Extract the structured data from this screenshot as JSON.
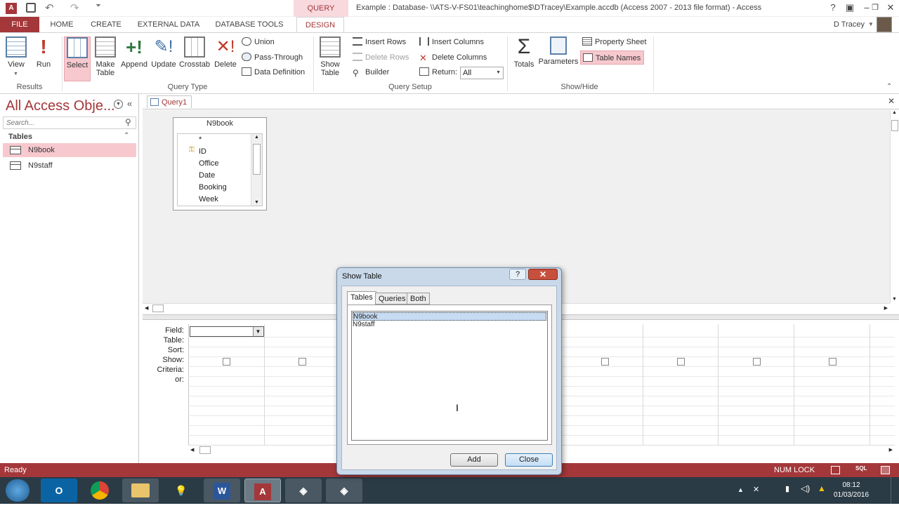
{
  "window": {
    "context_tab": "QUERY TOOLS",
    "title": "Example : Database- \\\\ATS-V-FS01\\teachinghome$\\DTracey\\Example.accdb (Access 2007 - 2013 file format) - Access",
    "help": "?"
  },
  "tabs": [
    "FILE",
    "HOME",
    "CREATE",
    "EXTERNAL DATA",
    "DATABASE TOOLS",
    "DESIGN"
  ],
  "user": "D Tracey",
  "ribbon": {
    "results": {
      "label": "Results",
      "view": "View",
      "run": "Run"
    },
    "query_type": {
      "label": "Query Type",
      "select": "Select",
      "make_table_1": "Make",
      "make_table_2": "Table",
      "append": "Append",
      "update": "Update",
      "crosstab": "Crosstab",
      "delete": "Delete",
      "union": "Union",
      "pass_through": "Pass-Through",
      "data_definition": "Data Definition"
    },
    "query_setup": {
      "label": "Query Setup",
      "show_table_1": "Show",
      "show_table_2": "Table",
      "insert_rows": "Insert Rows",
      "delete_rows": "Delete Rows",
      "builder": "Builder",
      "insert_columns": "Insert Columns",
      "delete_columns": "Delete Columns",
      "return": "Return:",
      "return_value": "All"
    },
    "show_hide": {
      "label": "Show/Hide",
      "totals": "Totals",
      "parameters": "Parameters",
      "property_sheet": "Property Sheet",
      "table_names": "Table Names"
    }
  },
  "nav": {
    "title": "All Access Obje...",
    "search_placeholder": "Search...",
    "group": "Tables",
    "items": [
      "N9book",
      "N9staff"
    ]
  },
  "document": {
    "tab": "Query1",
    "table": {
      "name": "N9book",
      "fields": [
        "*",
        "ID",
        "Office",
        "Date",
        "Booking",
        "Week"
      ]
    },
    "grid_rows": [
      "Field:",
      "Table:",
      "Sort:",
      "Show:",
      "Criteria:",
      "or:"
    ]
  },
  "dialog": {
    "title": "Show Table",
    "tabs": [
      "Tables",
      "Queries",
      "Both"
    ],
    "items": [
      "N9book",
      "N9staff"
    ],
    "add": "Add",
    "close": "Close"
  },
  "status": {
    "ready": "Ready",
    "num_lock": "NUM LOCK"
  },
  "clock": {
    "time": "08:12",
    "date": "01/03/2016"
  }
}
